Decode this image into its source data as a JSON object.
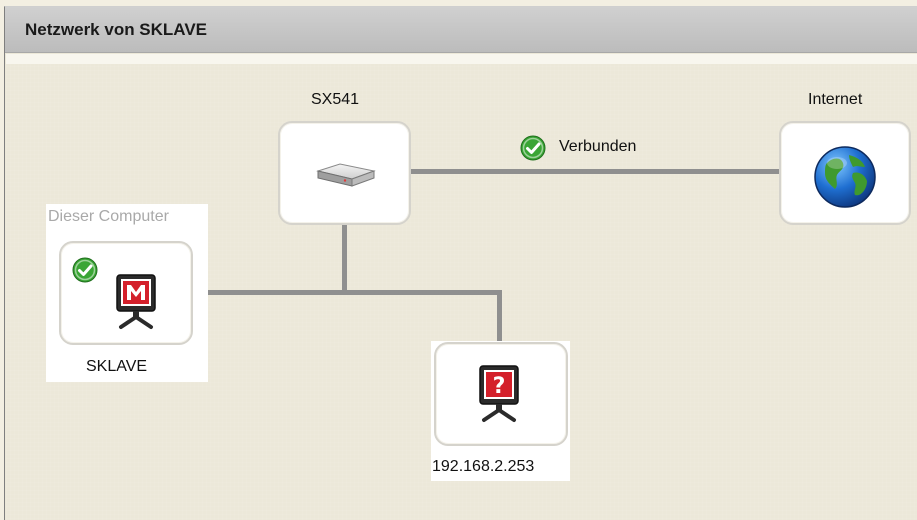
{
  "panel": {
    "title": "Netzwerk von SKLAVE"
  },
  "nodes": {
    "router": {
      "label": "SX541",
      "icon": "router-icon"
    },
    "internet": {
      "label": "Internet",
      "icon": "globe-icon"
    },
    "computer": {
      "caption": "Dieser Computer",
      "label": "SKLAVE",
      "icon": "mcafee-monitor-icon",
      "status_icon": "check-icon"
    },
    "unknown": {
      "label": "192.168.2.253",
      "icon": "unknown-monitor-icon"
    }
  },
  "connection": {
    "status_label": "Verbunden",
    "status_icon": "check-icon"
  },
  "colors": {
    "header_bg": "#c4c4c4",
    "canvas_bg": "#ede9da",
    "link": "#8f8f8f",
    "check_green": "#3aa535",
    "mcafee_red": "#d4202b"
  }
}
